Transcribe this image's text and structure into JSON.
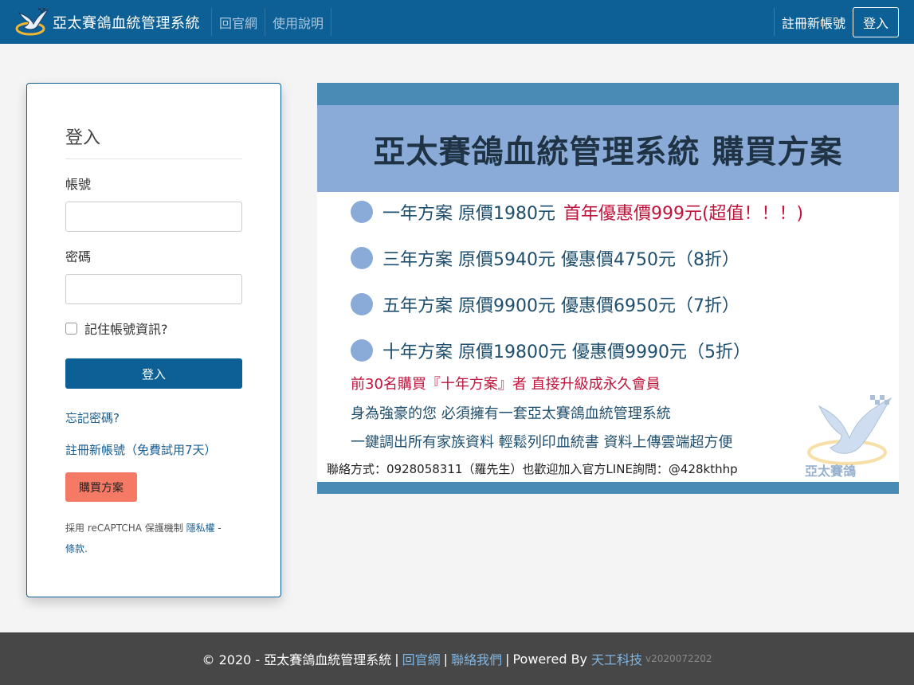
{
  "navbar": {
    "brand": "亞太賽鴿血統管理系統",
    "links": [
      "回官網",
      "使用說明"
    ],
    "register": "註冊新帳號",
    "login": "登入"
  },
  "login_form": {
    "title": "登入",
    "account_label": "帳號",
    "account_value": "",
    "password_label": "密碼",
    "password_value": "",
    "remember_label": "記住帳號資訊?",
    "remember_checked": false,
    "submit": "登入",
    "forgot": "忘記密碼?",
    "register": "註冊新帳號（免費試用7天）",
    "buy": "購買方案",
    "recaptcha_prefix": "採用 reCAPTCHA 保護機制 ",
    "privacy": "隱私權",
    "dash": " -",
    "terms": "條款",
    "period": "."
  },
  "promo": {
    "title": "亞太賽鴿血統管理系統 購買方案",
    "plans": [
      {
        "text": "一年方案 原價1980元",
        "highlight": "首年優惠價999元(超值！！！)"
      },
      {
        "text": "三年方案 原價5940元 優惠價4750元（8折）",
        "highlight": ""
      },
      {
        "text": "五年方案 原價9900元 優惠價6950元（7折）",
        "highlight": ""
      },
      {
        "text": "十年方案 原價19800元 優惠價9990元（5折）",
        "highlight": ""
      }
    ],
    "note_red": "前30名購買『十年方案』者 直接升級成永久會員",
    "note_blue_1": "身為強豪的您 必須擁有一套亞太賽鴿血統管理系統",
    "note_blue_2": "一鍵調出所有家族資料 輕鬆列印血統書 資料上傳雲端超方便",
    "contact": "聯絡方式：0928058311（羅先生）也歡迎加入官方LINE詢問：@428kthhp",
    "watermark_text": "亞太賽鴿"
  },
  "footer": {
    "copyright": "© 2020 - 亞太賽鴿血統管理系統",
    "link1": "回官網",
    "link2": "聯絡我們",
    "powered": "Powered By",
    "company": "天工科技",
    "version": "v2020072202"
  },
  "colors": {
    "navbar": "#0d6096",
    "primary_button": "#0d6096",
    "buy_button": "#f47a65",
    "promo_band": "#8aabd8",
    "promo_bar": "#4a8bb5",
    "footer": "#474747"
  }
}
